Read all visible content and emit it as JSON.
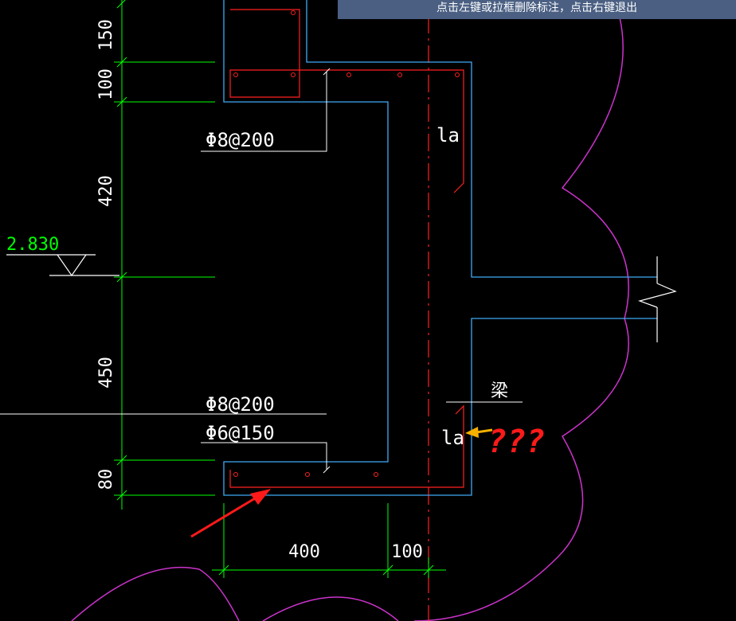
{
  "prompt": {
    "text": "点击左键或拉框删除标注，点击右键退出"
  },
  "dimensions": {
    "left": [
      "150",
      "100",
      "420",
      "450",
      "80"
    ],
    "bottom": [
      "400",
      "100"
    ]
  },
  "elevation": "2.830",
  "rebar_labels": {
    "top_bar": "Φ8@200",
    "bottom_bar_1": "Φ8@200",
    "bottom_bar_2": "Φ6@150"
  },
  "anchorage": {
    "top": "la",
    "bottom": "la"
  },
  "beam_label": "梁",
  "annotation": {
    "question": "???"
  },
  "colors": {
    "background": "#000000",
    "dimension": "#00ff00",
    "concrete_outline": "#3fa9f5",
    "rebar": "#ff2020",
    "axis": "#ff2020",
    "cloud": "#cc33cc",
    "text": "#ffffff",
    "prompt_bar": "#4a5f82",
    "annotation_red": "#ff1a1a",
    "annotation_arrow_yellow": "#f5b000"
  }
}
